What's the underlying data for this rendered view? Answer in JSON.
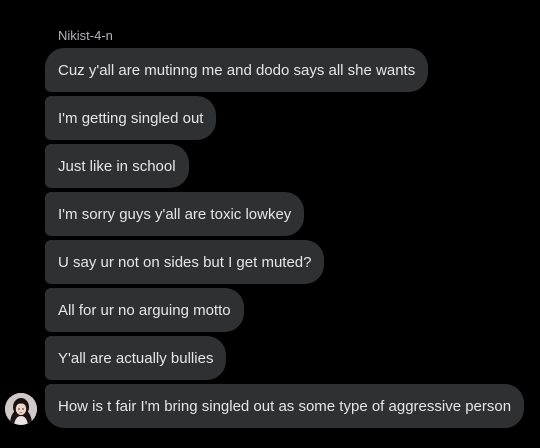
{
  "conversation": {
    "sender_name": "Nikist-4-n",
    "messages": [
      "Cuz y'all are mutinng me and dodo says all she wants",
      "I'm getting singled out",
      "Just like in school",
      "I'm sorry guys y'all are toxic lowkey",
      "U say ur not on sides but I get muted?",
      "All for ur no arguing motto",
      "Y'all are actually bullies",
      "How is t fair I'm bring singled out as some type of aggressive person"
    ]
  },
  "colors": {
    "background": "#000000",
    "bubble": "#2f3031",
    "bubble_text": "#e4e6eb",
    "sender_name": "#b0b3b8"
  },
  "icons": {
    "avatar": "sender-avatar"
  }
}
